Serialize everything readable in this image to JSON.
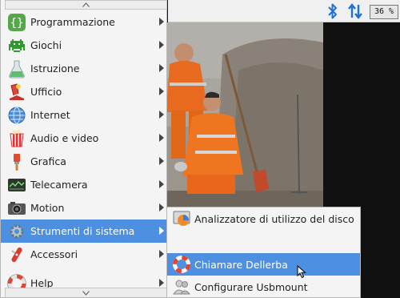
{
  "panel": {
    "cpu_label": "36 %",
    "icons": [
      "bluetooth-icon",
      "network-updown-icon",
      "cpu-monitor-icon"
    ],
    "accent": "#1e72d6"
  },
  "menu": {
    "highlight": "#4d8fe0",
    "items": [
      {
        "label": "Programmazione",
        "icon": "programming-icon"
      },
      {
        "label": "Giochi",
        "icon": "games-icon"
      },
      {
        "label": "Istruzione",
        "icon": "education-icon"
      },
      {
        "label": "Ufficio",
        "icon": "office-icon"
      },
      {
        "label": "Internet",
        "icon": "internet-globe-icon"
      },
      {
        "label": "Audio e video",
        "icon": "audio-video-icon"
      },
      {
        "label": "Grafica",
        "icon": "graphics-icon"
      },
      {
        "label": "Telecamera",
        "icon": "camera-icon"
      },
      {
        "label": "Motion",
        "icon": "motion-camera-icon"
      },
      {
        "label": "Strumenti di sistema",
        "icon": "system-tools-icon"
      },
      {
        "label": "Accessori",
        "icon": "accessories-icon"
      },
      {
        "label": "Help",
        "icon": "help-lifebuoy-icon"
      }
    ]
  },
  "submenu": {
    "items": [
      {
        "label": "Analizzatore di utilizzo del disco",
        "icon": "disk-usage-icon"
      },
      {
        "label": "Chiamare Dellerba",
        "icon": "lifebuoy-icon"
      },
      {
        "label": "Configurare Usbmount",
        "icon": "users-icon"
      }
    ]
  }
}
